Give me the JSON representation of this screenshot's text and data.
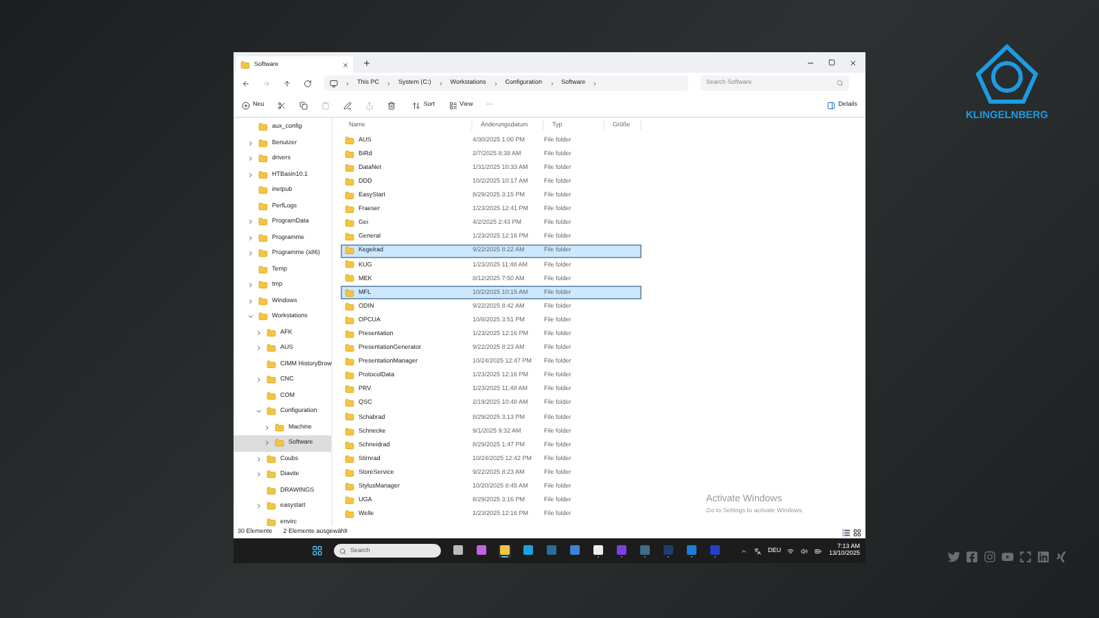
{
  "window": {
    "tab_title": "Software",
    "breadcrumb": [
      "This PC",
      "System (C:)",
      "Workstations",
      "Configuration",
      "Software"
    ],
    "search": {
      "placeholder": "Search Software"
    }
  },
  "toolbar": {
    "new": "Neu",
    "sort": "Sort",
    "view": "View",
    "more": "···",
    "details": "Details"
  },
  "sidebar": {
    "items": [
      {
        "label": "aux_config",
        "kind": "leaf",
        "selected": false
      },
      {
        "label": "Benutzer",
        "kind": "closed",
        "selected": false
      },
      {
        "label": "drivers",
        "kind": "closed",
        "selected": false
      },
      {
        "label": "HTBasin10.1",
        "kind": "closed",
        "selected": false
      },
      {
        "label": "inetpub",
        "kind": "leaf",
        "selected": false
      },
      {
        "label": "PerfLogs",
        "kind": "leaf",
        "selected": false
      },
      {
        "label": "ProgramData",
        "kind": "closed",
        "selected": false
      },
      {
        "label": "Programme",
        "kind": "closed",
        "selected": false
      },
      {
        "label": "Programme (x86)",
        "kind": "closed",
        "selected": false
      },
      {
        "label": "Temp",
        "kind": "leaf",
        "selected": false
      },
      {
        "label": "tmp",
        "kind": "closed",
        "selected": false
      },
      {
        "label": "Windows",
        "kind": "closed",
        "selected": false
      },
      {
        "label": "Workstations",
        "kind": "open",
        "selected": false,
        "children": [
          {
            "label": "AFK",
            "kind": "closed",
            "selected": false
          },
          {
            "label": "AUS",
            "kind": "closed",
            "selected": false
          },
          {
            "label": "CIMM HistoryBrow",
            "kind": "leaf",
            "selected": false
          },
          {
            "label": "CNC",
            "kind": "closed",
            "selected": false
          },
          {
            "label": "COM",
            "kind": "leaf",
            "selected": false
          },
          {
            "label": "Configuration",
            "kind": "open",
            "selected": false,
            "children": [
              {
                "label": "Machine",
                "kind": "closed",
                "selected": false
              },
              {
                "label": "Software",
                "kind": "closed",
                "selected": true
              }
            ]
          },
          {
            "label": "Coubs",
            "kind": "closed",
            "selected": false
          },
          {
            "label": "Diavite",
            "kind": "closed",
            "selected": false
          },
          {
            "label": "DRAWINGS",
            "kind": "leaf",
            "selected": false
          },
          {
            "label": "easystart",
            "kind": "closed",
            "selected": false
          },
          {
            "label": "envirc",
            "kind": "leaf",
            "selected": false
          }
        ]
      }
    ]
  },
  "table": {
    "columns": [
      "Name",
      "Änderungsdatum",
      "Typ",
      "Größe"
    ],
    "rows": [
      {
        "name": "AUS",
        "date": "4/30/2025 1:00 PM",
        "type": "File folder",
        "selected": false
      },
      {
        "name": "BiRd",
        "date": "2/7/2025 8:38 AM",
        "type": "File folder",
        "selected": false
      },
      {
        "name": "DataNet",
        "date": "1/31/2025 10:33 AM",
        "type": "File folder",
        "selected": false
      },
      {
        "name": "DDD",
        "date": "10/2/2025 10:17 AM",
        "type": "File folder",
        "selected": false
      },
      {
        "name": "EasyStart",
        "date": "8/29/2025 3:15 PM",
        "type": "File folder",
        "selected": false
      },
      {
        "name": "Fraeser",
        "date": "1/23/2025 12:41 PM",
        "type": "File folder",
        "selected": false
      },
      {
        "name": "Gei",
        "date": "4/2/2025 2:43 PM",
        "type": "File folder",
        "selected": false
      },
      {
        "name": "General",
        "date": "1/23/2025 12:16 PM",
        "type": "File folder",
        "selected": false
      },
      {
        "name": "Kegelrad",
        "date": "9/22/2025 8:22 AM",
        "type": "File folder",
        "selected": true
      },
      {
        "name": "KUG",
        "date": "1/23/2025 11:48 AM",
        "type": "File folder",
        "selected": false
      },
      {
        "name": "MEK",
        "date": "8/12/2025 7:50 AM",
        "type": "File folder",
        "selected": false
      },
      {
        "name": "MFL",
        "date": "10/2/2025 10:15 AM",
        "type": "File folder",
        "selected": true
      },
      {
        "name": "ODIN",
        "date": "9/22/2025 8:42 AM",
        "type": "File folder",
        "selected": false
      },
      {
        "name": "OPCUA",
        "date": "10/8/2025 3:51 PM",
        "type": "File folder",
        "selected": false
      },
      {
        "name": "Presentation",
        "date": "1/23/2025 12:16 PM",
        "type": "File folder",
        "selected": false
      },
      {
        "name": "PresentationGenerator",
        "date": "9/22/2025 8:23 AM",
        "type": "File folder",
        "selected": false
      },
      {
        "name": "PresentationManager",
        "date": "10/24/2025 12:47 PM",
        "type": "File folder",
        "selected": false
      },
      {
        "name": "ProtocolData",
        "date": "1/23/2025 12:16 PM",
        "type": "File folder",
        "selected": false
      },
      {
        "name": "PRV",
        "date": "1/23/2025 11:48 AM",
        "type": "File folder",
        "selected": false
      },
      {
        "name": "QSC",
        "date": "2/19/2025 10:48 AM",
        "type": "File folder",
        "selected": false
      },
      {
        "name": "Schabrad",
        "date": "8/29/2025 3:13 PM",
        "type": "File folder",
        "selected": false
      },
      {
        "name": "Schnecke",
        "date": "9/1/2025 9:32 AM",
        "type": "File folder",
        "selected": false
      },
      {
        "name": "Schneidrad",
        "date": "8/29/2025 1:47 PM",
        "type": "File folder",
        "selected": false
      },
      {
        "name": "Stirnrad",
        "date": "10/24/2025 12:42 PM",
        "type": "File folder",
        "selected": false
      },
      {
        "name": "StoreService",
        "date": "9/22/2025 8:23 AM",
        "type": "File folder",
        "selected": false
      },
      {
        "name": "StylusManager",
        "date": "10/20/2025 8:45 AM",
        "type": "File folder",
        "selected": false
      },
      {
        "name": "UGA",
        "date": "8/29/2025 3:16 PM",
        "type": "File folder",
        "selected": false
      },
      {
        "name": "Welle",
        "date": "1/23/2025 12:16 PM",
        "type": "File folder",
        "selected": false
      }
    ]
  },
  "status_bar": {
    "count": "30 Elemente",
    "selection": "2 Elemente ausgewählt"
  },
  "activation": {
    "title": "Activate Windows",
    "subtitle": "Go to Settings to activate Windows."
  },
  "taskbar": {
    "search": {
      "placeholder": "Search"
    },
    "apps": [
      {
        "selected": false,
        "running": false
      },
      {
        "selected": false,
        "running": false
      },
      {
        "selected": true,
        "running": true
      },
      {
        "selected": false,
        "running": false
      },
      {
        "selected": false,
        "running": false
      },
      {
        "selected": false,
        "running": false
      },
      {
        "selected": false,
        "running": true
      },
      {
        "selected": false,
        "running": true
      },
      {
        "selected": false,
        "running": true
      },
      {
        "selected": false,
        "running": true
      },
      {
        "selected": false,
        "running": true
      },
      {
        "selected": false,
        "running": true
      }
    ],
    "language": "DEU",
    "time": "7:13 AM",
    "date": "13/10/2025"
  },
  "brand": {
    "name": "KLINGELNBERG"
  }
}
